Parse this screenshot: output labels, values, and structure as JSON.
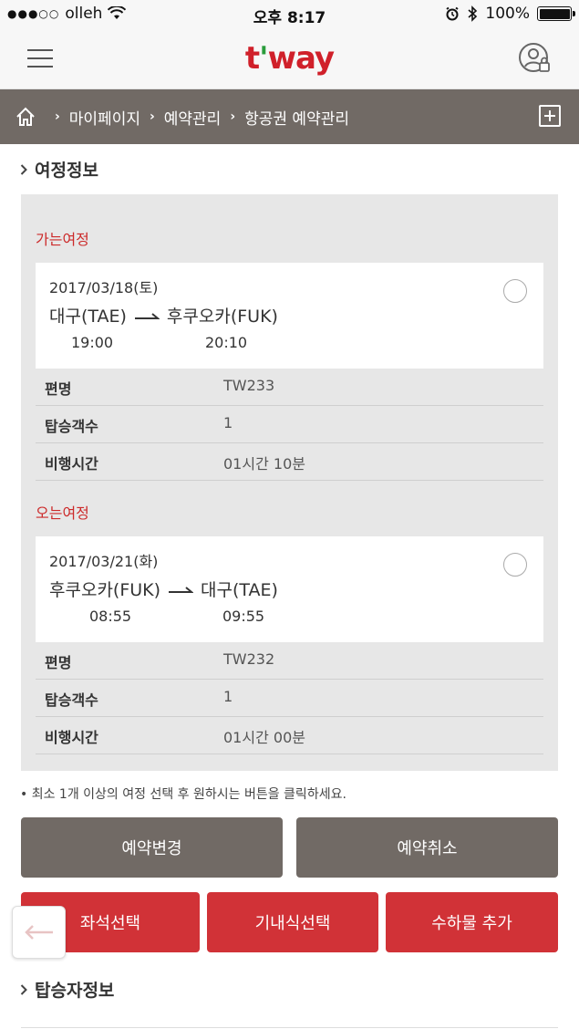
{
  "status_bar": {
    "carrier": "olleh",
    "time": "오후 8:17",
    "battery": "100%"
  },
  "header": {
    "logo": "t'way",
    "logo_parts": [
      "t",
      "'",
      "way"
    ],
    "brand_color": "#d0202a"
  },
  "breadcrumb": {
    "items": [
      "마이페이지",
      "예약관리",
      "항공권 예약관리"
    ],
    "background": "#716a65"
  },
  "itinerary": {
    "section_title": "여정정보",
    "outbound": {
      "label": "가는여정",
      "date": "2017/03/18(토)",
      "from": "대구(TAE)",
      "to": "후쿠오카(FUK)",
      "depart_time": "19:00",
      "arrive_time": "20:10",
      "rows": [
        {
          "key": "편명",
          "value": "TW233"
        },
        {
          "key": "탑승객수",
          "value": "1"
        },
        {
          "key": "비행시간",
          "value": "01시간 10분"
        }
      ]
    },
    "inbound": {
      "label": "오는여정",
      "date": "2017/03/21(화)",
      "from": "후쿠오카(FUK)",
      "to": "대구(TAE)",
      "depart_time": "08:55",
      "arrive_time": "09:55",
      "rows": [
        {
          "key": "편명",
          "value": "TW232"
        },
        {
          "key": "탑승객수",
          "value": "1"
        },
        {
          "key": "비행시간",
          "value": "01시간 00분"
        }
      ]
    }
  },
  "notice": "• 최소 1개 이상의 여정 선택 후 원하시는 버튼을 클릭하세요.",
  "buttons": {
    "change": "예약변경",
    "cancel": "예약취소",
    "seat": "좌석선택",
    "meal": "기내식선택",
    "baggage": "수하물 추가"
  },
  "passenger_section_title": "탑승자정보",
  "colors": {
    "accent_red": "#d13237",
    "gray_button": "#716a65",
    "leg_label": "#cc2a2a"
  }
}
